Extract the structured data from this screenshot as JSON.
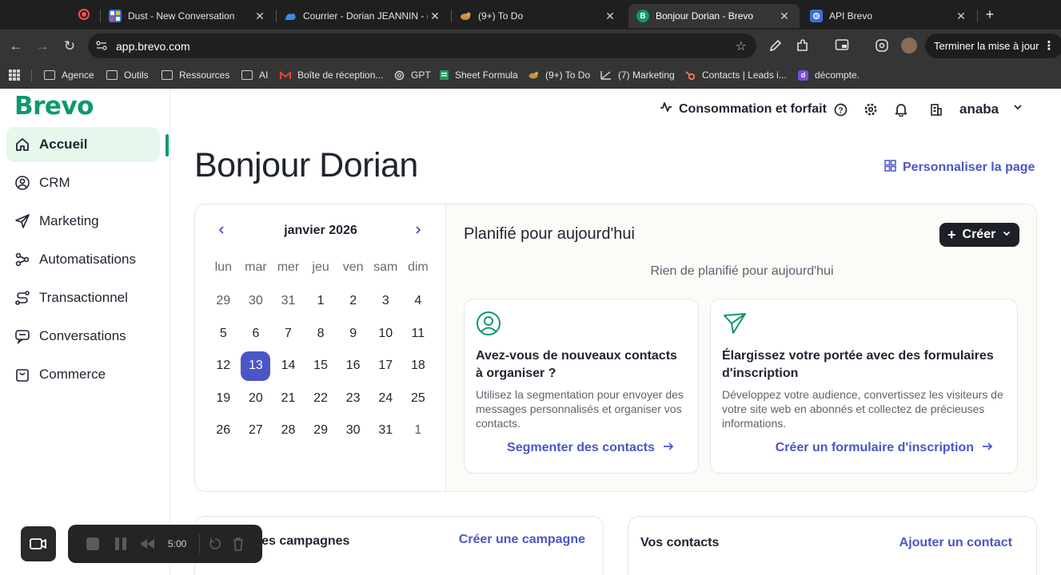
{
  "browser": {
    "tabs": [
      {
        "title": "Dust - New Conversation",
        "icon": "dust-icon"
      },
      {
        "title": "Courrier - Dorian JEANNIN - (",
        "icon": "outlook-icon"
      },
      {
        "title": "(9+) To Do",
        "icon": "todo-bird-icon"
      },
      {
        "title": "Bonjour Dorian - Brevo",
        "icon": "brevo-b-icon",
        "favicon_text": "B"
      },
      {
        "title": "API Brevo",
        "icon": "gear-icon"
      }
    ],
    "url": "app.brevo.com",
    "update_button": "Terminer la mise à jour",
    "bookmarks": [
      {
        "label": "Agence",
        "icon": "folder-icon"
      },
      {
        "label": "Outils",
        "icon": "folder-icon"
      },
      {
        "label": "Ressources",
        "icon": "folder-icon"
      },
      {
        "label": "AI",
        "icon": "folder-icon"
      },
      {
        "label": "Boîte de réception...",
        "icon": "gmail-icon"
      },
      {
        "label": "GPT",
        "icon": "openai-icon"
      },
      {
        "label": "Sheet Formula",
        "icon": "sheet-icon"
      },
      {
        "label": "(9+) To Do",
        "icon": "todo-bird-icon"
      },
      {
        "label": "(7) Marketing",
        "icon": "chart-icon"
      },
      {
        "label": "Contacts | Leads i...",
        "icon": "hubspot-icon"
      },
      {
        "label": "décompte.",
        "icon": "d-icon",
        "favicon_text": "d"
      }
    ]
  },
  "app": {
    "logo": "Brevo",
    "brand_color": "#0b996e",
    "accent_color": "#4b55c8",
    "sidebar": [
      {
        "label": "Accueil",
        "icon": "home-icon",
        "active": true
      },
      {
        "label": "CRM",
        "icon": "at-sign-icon"
      },
      {
        "label": "Marketing",
        "icon": "send-icon"
      },
      {
        "label": "Automatisations",
        "icon": "workflow-icon"
      },
      {
        "label": "Transactionnel",
        "icon": "route-icon"
      },
      {
        "label": "Conversations",
        "icon": "chat-icon"
      },
      {
        "label": "Commerce",
        "icon": "bag-icon"
      }
    ],
    "header": {
      "plan_label": "Consommation et forfait",
      "account_name": "anaba"
    },
    "greeting": "Bonjour Dorian",
    "customize_label": "Personnaliser la page",
    "calendar": {
      "month": "janvier 2026",
      "weekdays": [
        "lun",
        "mar",
        "mer",
        "jeu",
        "ven",
        "sam",
        "dim"
      ],
      "days": [
        {
          "d": "29",
          "muted": true
        },
        {
          "d": "30",
          "muted": true
        },
        {
          "d": "31",
          "muted": true
        },
        {
          "d": "1"
        },
        {
          "d": "2"
        },
        {
          "d": "3"
        },
        {
          "d": "4"
        },
        {
          "d": "5"
        },
        {
          "d": "6"
        },
        {
          "d": "7"
        },
        {
          "d": "8"
        },
        {
          "d": "9"
        },
        {
          "d": "10"
        },
        {
          "d": "11"
        },
        {
          "d": "12"
        },
        {
          "d": "13",
          "today": true
        },
        {
          "d": "14"
        },
        {
          "d": "15"
        },
        {
          "d": "16"
        },
        {
          "d": "17"
        },
        {
          "d": "18"
        },
        {
          "d": "19"
        },
        {
          "d": "20"
        },
        {
          "d": "21"
        },
        {
          "d": "22"
        },
        {
          "d": "23"
        },
        {
          "d": "24"
        },
        {
          "d": "25"
        },
        {
          "d": "26"
        },
        {
          "d": "27"
        },
        {
          "d": "28"
        },
        {
          "d": "29"
        },
        {
          "d": "30"
        },
        {
          "d": "31"
        },
        {
          "d": "1",
          "muted": true
        }
      ]
    },
    "planned": {
      "title": "Planifié pour aujourd'hui",
      "create_label": "Créer",
      "empty_text": "Rien de planifié pour aujourd'hui"
    },
    "tips": [
      {
        "icon": "user-circle-icon",
        "title": "Avez-vous de nouveaux contacts à organiser ?",
        "description": "Utilisez la segmentation pour envoyer des messages personnalisés et organiser vos contacts.",
        "link": "Segmenter des contacts"
      },
      {
        "icon": "send-icon",
        "title": "Élargissez votre portée avec des formulaires d'inscription",
        "description": "Développez votre audience, convertissez les visiteurs de votre site web en abonnés et collectez de précieuses informations.",
        "link": "Créer un formulaire d'inscription"
      }
    ],
    "campaigns_card": {
      "title": "ères campagnes",
      "link": "Créer une campagne"
    },
    "contacts_card": {
      "title": "Vos contacts",
      "link": "Ajouter un contact"
    }
  },
  "recorder": {
    "time": "5:00"
  }
}
